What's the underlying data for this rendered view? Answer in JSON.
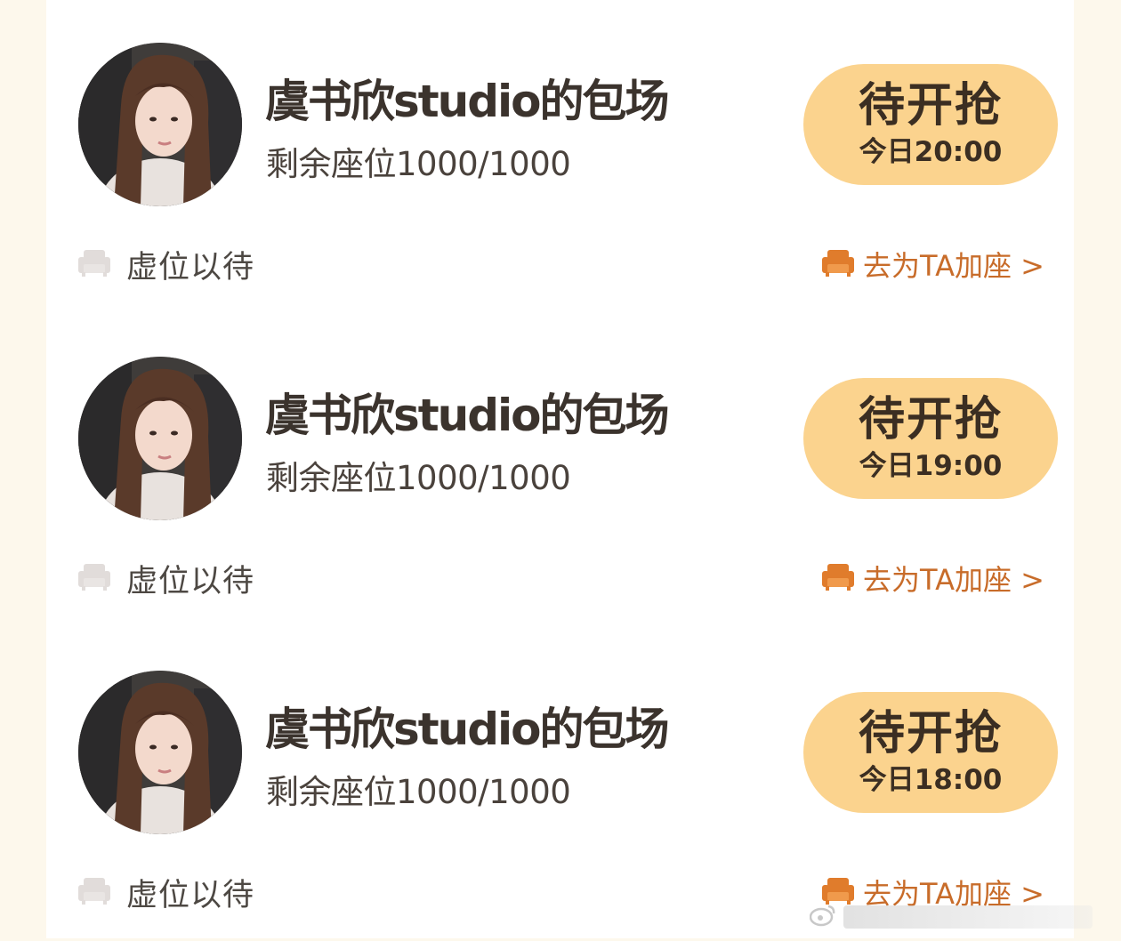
{
  "cards": [
    {
      "title": "虞书欣studio的包场",
      "seats": "剩余座位1000/1000",
      "button_label": "待开抢",
      "button_time": "今日20:00",
      "waiting_label": "虚位以待",
      "add_seat_label": "去为TA加座 >"
    },
    {
      "title": "虞书欣studio的包场",
      "seats": "剩余座位1000/1000",
      "button_label": "待开抢",
      "button_time": "今日19:00",
      "waiting_label": "虚位以待",
      "add_seat_label": "去为TA加座 >"
    },
    {
      "title": "虞书欣studio的包场",
      "seats": "剩余座位1000/1000",
      "button_label": "待开抢",
      "button_time": "今日18:00",
      "waiting_label": "虚位以待",
      "add_seat_label": "去为TA加座 >"
    }
  ],
  "icons": {
    "waiting_seat": "empty-seat-icon",
    "add_seat": "seat-icon"
  },
  "colors": {
    "button_bg": "#fbd38e",
    "accent": "#c86c2a",
    "page_bg": "#fdf8ec"
  }
}
